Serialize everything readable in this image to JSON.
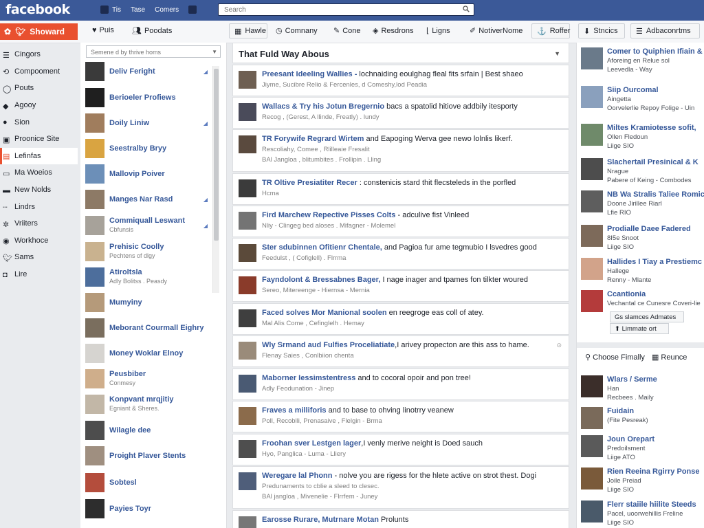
{
  "topbar": {
    "logo": "facebook",
    "nav": [
      "Tis",
      "Tase",
      "Comers"
    ],
    "search_placeholder": "Search"
  },
  "toolbar": {
    "share": "Showard",
    "items": [
      "Puis",
      "Poodats"
    ],
    "tabs": [
      "Hawle",
      "Comnany",
      "Cone",
      "Resdrons",
      "Ligns",
      "NotiverNome",
      "Roffer"
    ],
    "actions": [
      "Stncics",
      "Adbaconrtms"
    ]
  },
  "leftnav": {
    "items": [
      "Cingors",
      "Compooment",
      "Pouts",
      "Agooy",
      "Sion",
      "Proonice Site",
      "Lefinfas",
      "Ma Woeios",
      "New Nolds",
      "Lindrs",
      "Vriiters",
      "Workhoce",
      "Sams",
      "Lire"
    ],
    "active_index": 6,
    "accent": "#e9502f"
  },
  "friends": {
    "search_placeholder": "Semene d by thrive homs",
    "rows": [
      {
        "name": "Deliv Feright",
        "sub": ""
      },
      {
        "name": "Berioeler Profiews",
        "sub": ""
      },
      {
        "name": "Doily Liniw",
        "sub": ""
      },
      {
        "name": "Seestralby Bryy",
        "sub": ""
      },
      {
        "name": "Mallovip Poiver",
        "sub": ""
      },
      {
        "name": "Manges Nar Rasd",
        "sub": ""
      },
      {
        "name": "Commiquall Leswant",
        "sub": "Cbfunsis"
      },
      {
        "name": "Prehisic Coolly",
        "sub": "Pechtens of dlgy"
      },
      {
        "name": "Atiroltsla",
        "sub": "Adly Bolitss . Peasdy"
      },
      {
        "name": "Mumyiny",
        "sub": ""
      },
      {
        "name": "Meborant Courmall Eighry",
        "sub": ""
      },
      {
        "name": "Money Woklar Elnoy",
        "sub": ""
      },
      {
        "name": "Peusbiber",
        "sub": "Conmesy"
      },
      {
        "name": "Konpvant mrqjitiy",
        "sub": "Egniant & Sheres."
      },
      {
        "name": "Wilagle dee",
        "sub": ""
      },
      {
        "name": "Proight Plaver Stents",
        "sub": ""
      },
      {
        "name": "Sobtesl",
        "sub": ""
      },
      {
        "name": "Payies Toyr",
        "sub": ""
      }
    ]
  },
  "feed": {
    "title": "That Fuld Way Abous",
    "stories": [
      {
        "title": "Preesant Ideeling Wallies -",
        "body": " lochnaiding eoulghag fleal fits srfain | Best shaeo",
        "meta": "Jiyme, Sucibre Relio & Fercenles, d  Comeshy,lod Peadia"
      },
      {
        "title": "Wallacs & Try his Jotun Bregernio",
        "body": " bacs a spatolid hitiove addbily itesporty",
        "meta": "Recog , (Gerest, A llinde, Freatly)  . lundy"
      },
      {
        "title": "TR Forywife Regrard Wirtem",
        "body": " and Eapoging Werva gee newo lolnlis likerf.",
        "meta": "Rescoliahy, Comee , Rlilleaie Fresalit",
        "meta2": "BAl  Jangloa , blitumbites . Frollipin   . Lling"
      },
      {
        "title": "TR Oltive Presiatiter Recer",
        "body": " : constenicis stard thit flecsteleds in the porfled",
        "meta": "Hcma"
      },
      {
        "title": "Fird Marchew Repective Pisses Colts",
        "body": " - adculive fist Vinleed",
        "meta": "Nliy - Clingeg bed aloses . Mifagner  - Molemel"
      },
      {
        "title": "Ster sdubinnen Ofitienr Chentale,",
        "body": " and Pagioa fur ame tegmubio I lsvedres good",
        "meta": "Feedulst , ( Cofiglell)  . Flrrma"
      },
      {
        "title": "Fayndolont & Bressabnes Bager,",
        "body": " I  nage inager and tpames fon tilkter woured",
        "meta": "Sereo, Mitereenge  - Hiernsa - Mernia"
      },
      {
        "title": "Faced solves Mor Manional soolen",
        "body": " en reegroge eas  coll of atey.",
        "meta": "Mal Alis Come , Cefinglelh  . Hemay"
      },
      {
        "title": "Wly Srmand aud Fulfies Proceliatiate",
        "body": ",I arivey propecton are this ass to hame.",
        "meta": "Flenay Saies , Conlbiion   chenta"
      },
      {
        "title": "Maborner Iessimstentress",
        "body": " and to cocoral opoir and pon tree!",
        "meta": "Adly Feodunation  - Jinep"
      },
      {
        "title": "Fraves a milliforis",
        "body": " and to base to ohving linotrry veanew",
        "meta": "Poll, Recoblli, Prenasaive , Flelgin  - Brma"
      },
      {
        "title": "Froohan sver Lestgen lager",
        "body": ",I venly merive neight is Doed sauch",
        "meta": "Hyo, Panglica  - Luma  - Lliery"
      },
      {
        "title": "Weregare lal Phonn",
        "body": " - nolve you are rigess for the hlete active on strot thest. Dogi",
        "meta": "Predunaments to cblie a sleed to clesec.",
        "meta2": "BAl  jangloa , Mivenelie  - Flrrfem  - Juney"
      },
      {
        "title": "Earosse Rurare, Mutrnare Motan",
        "body": " Prolunts",
        "meta": ""
      }
    ]
  },
  "right": {
    "people": [
      {
        "name": "Comer to Quiphien Ifiain &",
        "sub": "Aforeing en Relue sol",
        "sub2": "Leevedla - Way"
      },
      {
        "name": "Siip Ourcomal",
        "sub": "Aingetta",
        "sub2": "Oorvelerlie Repoy Folige  - Uin"
      },
      {
        "name": "Miltes Kramiotesse sofit,",
        "sub": "Ollen Fledoun",
        "sub2": "Liige SIO"
      },
      {
        "name": "Slachertail Presinical & K",
        "sub": "Nrague",
        "sub2": "Pabere of Keing - Combodes"
      },
      {
        "name": "NB Wa Stralis Taliee Romic",
        "sub": "Doone Jirillee Riarl",
        "sub2": "Lfie RIO"
      },
      {
        "name": "Prodialle Daee Fadered",
        "sub": "8I5e Snoot",
        "sub2": "Liige SIO"
      },
      {
        "name": "Hallides I Tiay a Prestiemc",
        "sub": "Hallege",
        "sub2": "Renny  - Mlante"
      },
      {
        "name": "Ccantionia",
        "sub": "Vechantal ce Cunesre Coveri-lie",
        "sub2": ""
      }
    ],
    "btn1": "Gs slamces Admates",
    "btn2": "Limmate ort",
    "section_tabs": [
      "Choose Fimally",
      "Reunce"
    ],
    "people2": [
      {
        "name": "Wlars / Serme",
        "sub": "Han",
        "sub2": "Recbees . Maily"
      },
      {
        "name": "Fuidain",
        "sub": "(Fite Pesreak)",
        "sub2": ""
      },
      {
        "name": "Joun Orepart",
        "sub": "Predoilsment",
        "sub2": "Liige ATO"
      },
      {
        "name": "Rien Reeina Rgirry Ponse",
        "sub": "Joile Preiad",
        "sub2": "Liige SIO"
      },
      {
        "name": "Flerr staiile hiilite Steeds",
        "sub": "Pacel, uoorwehillis Freline",
        "sub2": "Liige SIO"
      }
    ]
  }
}
